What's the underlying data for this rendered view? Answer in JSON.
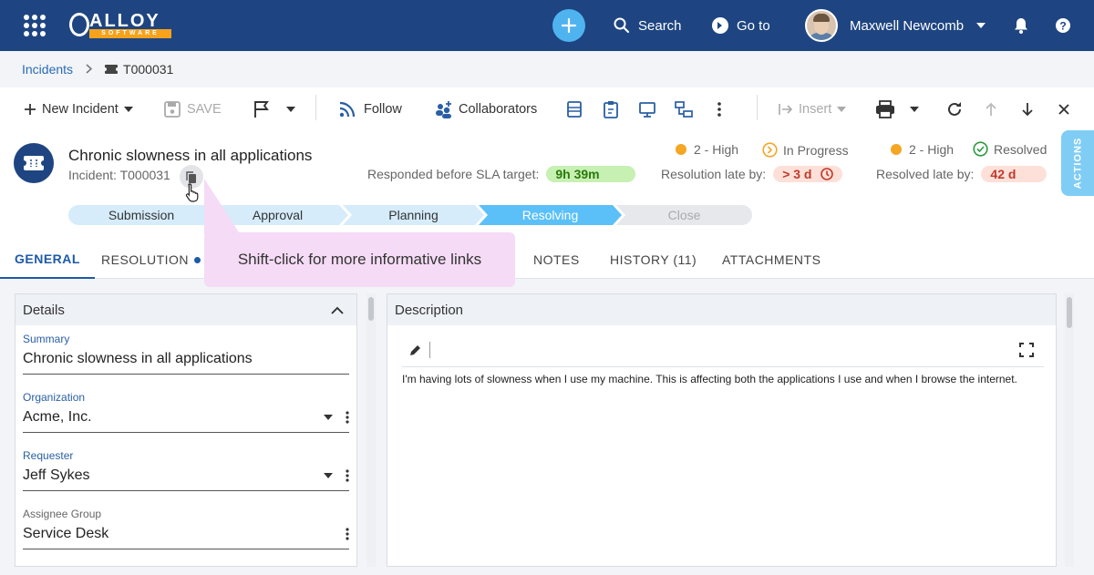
{
  "topbar": {
    "logo_text": "ALLOY",
    "logo_sub": "SOFTWARE",
    "search_label": "Search",
    "goto_label": "Go to",
    "user_name": "Maxwell Newcomb"
  },
  "breadcrumb": {
    "root": "Incidents",
    "current": "T000031"
  },
  "toolbar": {
    "new_incident": "New Incident",
    "save": "SAVE",
    "follow": "Follow",
    "collaborators": "Collaborators",
    "insert": "Insert"
  },
  "incident": {
    "title": "Chronic slowness in all applications",
    "id_label": "Incident:",
    "id": "T000031",
    "priority_1": "2 - High",
    "status_1": "In Progress",
    "responded_label": "Responded before SLA target:",
    "responded_value": "9h 39m",
    "resolution_label": "Resolution late by:",
    "resolution_value": "> 3 d",
    "priority_2": "2 - High",
    "status_2": "Resolved",
    "resolved_label": "Resolved late by:",
    "resolved_value": "42 d"
  },
  "stages": [
    "Submission",
    "Approval",
    "Planning",
    "Resolving",
    "Close"
  ],
  "actions_tab": "ACTIONS",
  "tabs": {
    "general": "GENERAL",
    "resolution": "RESOLUTION",
    "notes": "NOTES",
    "history": "HISTORY (11)",
    "attachments": "ATTACHMENTS"
  },
  "tooltip": "Shift-click for more informative links",
  "details": {
    "title": "Details",
    "fields": [
      {
        "label": "Summary",
        "value": "Chronic slowness in all applications"
      },
      {
        "label": "Organization",
        "value": "Acme, Inc."
      },
      {
        "label": "Requester",
        "value": "Jeff Sykes"
      },
      {
        "label": "Assignee Group",
        "value": "Service Desk"
      }
    ]
  },
  "description": {
    "title": "Description",
    "text": "I'm having lots of slowness when I use my machine. This is affecting both the applications I use and when I browse the internet."
  }
}
